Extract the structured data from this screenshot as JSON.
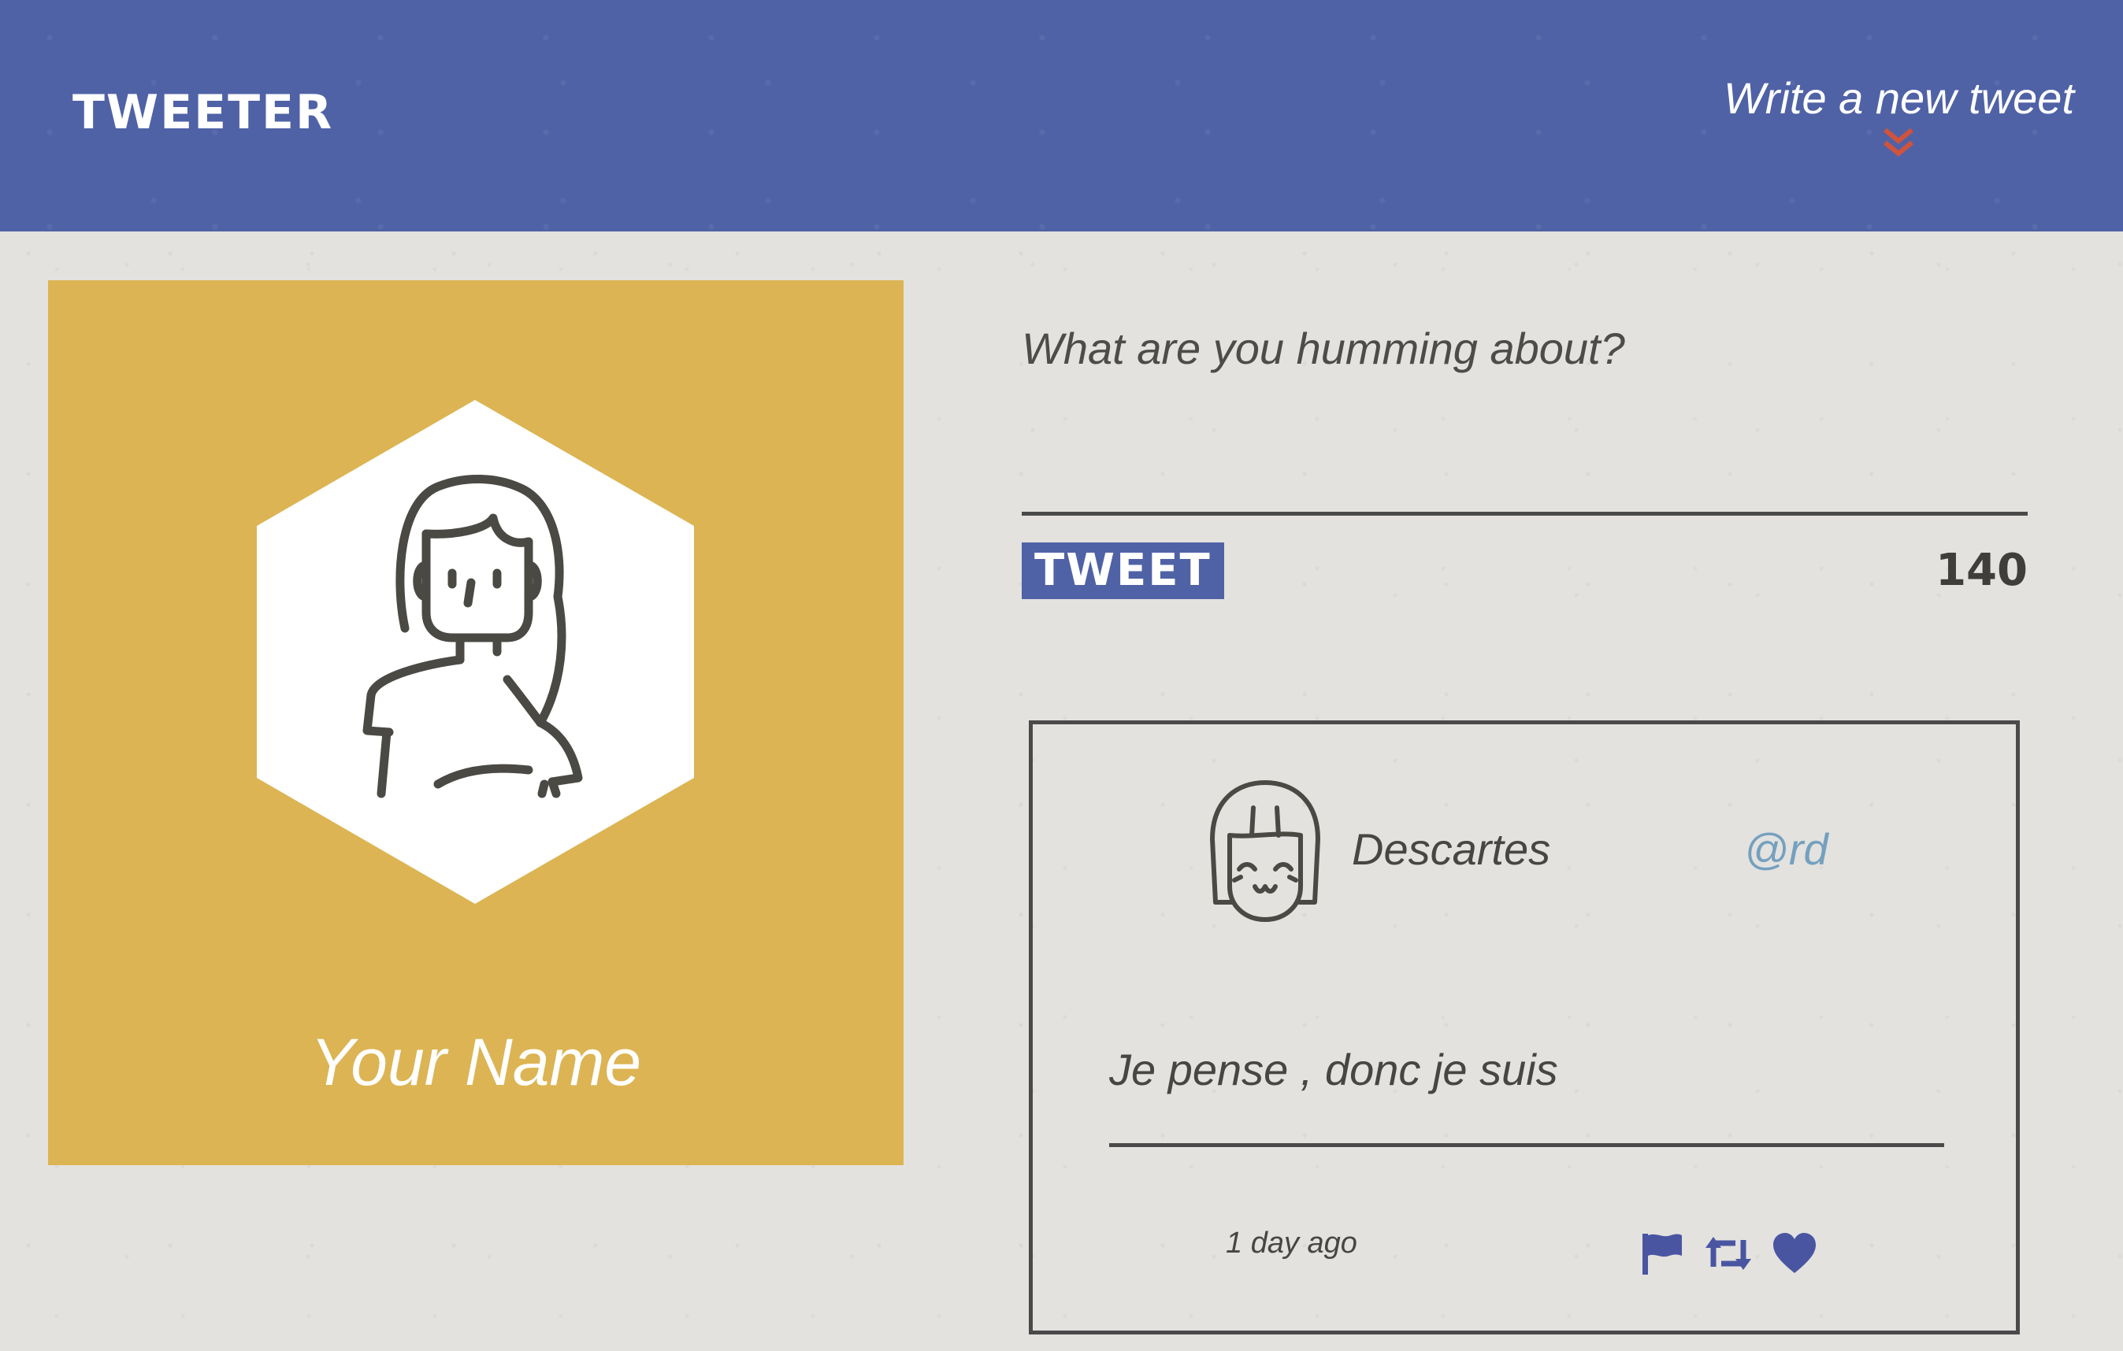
{
  "header": {
    "logo": "TWEETER",
    "compose_toggle_label": "Write a new tweet"
  },
  "profile": {
    "name": "Your Name"
  },
  "composer": {
    "placeholder": "What are you humming about?",
    "value": "",
    "submit_label": "TWEET",
    "char_count": "140"
  },
  "tweet": {
    "author_name": "Descartes",
    "handle": "@rd",
    "text": "Je pense , donc je suis",
    "timestamp": "1 day ago",
    "actions": [
      "flag-icon",
      "retweet-icon",
      "heart-icon"
    ]
  },
  "icons": {
    "compose_toggle": "chevron-down-double-icon"
  },
  "colors": {
    "header_bg": "#5062a6",
    "page_bg": "#e3e2df",
    "profile_bg": "#dcb453",
    "accent_red": "#d0533c",
    "handle": "#75a0bf",
    "text": "#474643",
    "action_icons": "#4a55a2"
  }
}
